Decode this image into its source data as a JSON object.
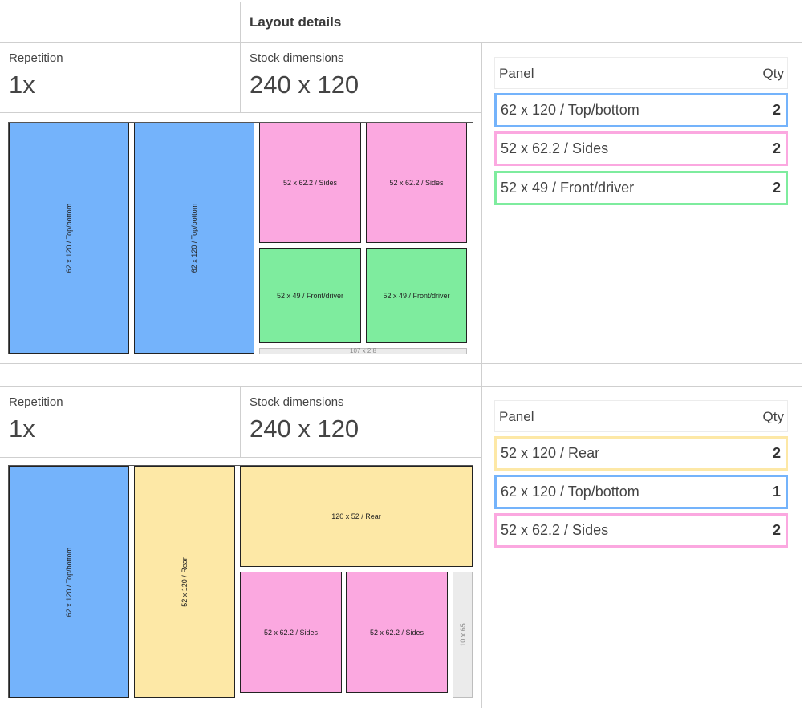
{
  "header": {
    "title": "Layout details"
  },
  "colors": {
    "top_bottom": "#74b3fb",
    "sides": "#fba8e0",
    "front_driver": "#7eec9e",
    "rear": "#fde8a6",
    "offcut": "#ebebeb",
    "border": "#cfcfcf"
  },
  "layouts": [
    {
      "repetition_label": "Repetition",
      "repetition_value": "1x",
      "stock_label": "Stock dimensions",
      "stock_value": "240 x 120",
      "pieces": [
        "62 x 120 / Top/bottom",
        "62 x 120 / Top/bottom",
        "52 x 62.2 / Sides",
        "52 x 62.2 / Sides",
        "52 x 49 / Front/driver",
        "52 x 49 / Front/driver",
        "107 x 2.8"
      ],
      "panels": {
        "header_name": "Panel",
        "header_qty": "Qty",
        "rows": [
          {
            "name": "62 x 120 / Top/bottom",
            "qty": "2",
            "color": "#74b3fb"
          },
          {
            "name": "52 x 62.2 / Sides",
            "qty": "2",
            "color": "#fba8e0"
          },
          {
            "name": "52 x 49 / Front/driver",
            "qty": "2",
            "color": "#7eec9e"
          }
        ]
      }
    },
    {
      "repetition_label": "Repetition",
      "repetition_value": "1x",
      "stock_label": "Stock dimensions",
      "stock_value": "240 x 120",
      "pieces": [
        "62 x 120 / Top/bottom",
        "52 x 120 / Rear",
        "120 x 52 / Rear",
        "52 x 62.2 / Sides",
        "52 x 62.2 / Sides",
        "10 x 65"
      ],
      "panels": {
        "header_name": "Panel",
        "header_qty": "Qty",
        "rows": [
          {
            "name": "52 x 120 / Rear",
            "qty": "2",
            "color": "#fde8a6"
          },
          {
            "name": "62 x 120 / Top/bottom",
            "qty": "1",
            "color": "#74b3fb"
          },
          {
            "name": "52 x 62.2 / Sides",
            "qty": "2",
            "color": "#fba8e0"
          }
        ]
      }
    }
  ]
}
